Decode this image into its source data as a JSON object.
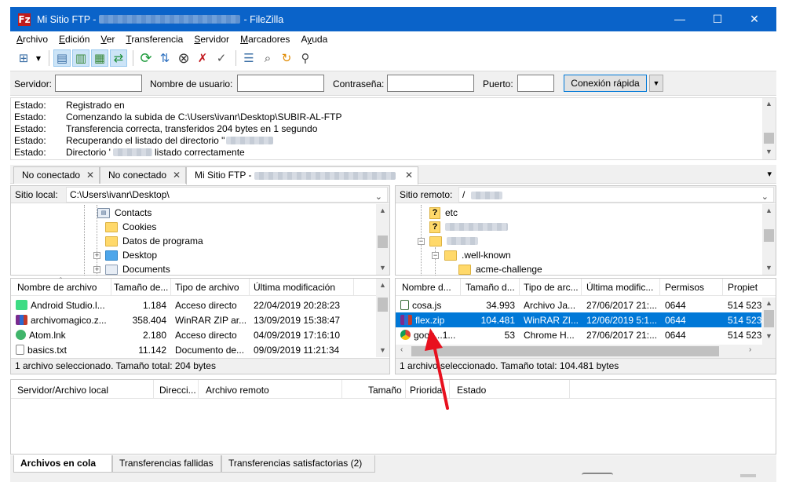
{
  "window": {
    "app_icon": "Fz",
    "title_prefix": "Mi Sitio FTP - ",
    "title_suffix": " - FileZilla",
    "minimize": "—",
    "maximize": "☐",
    "close": "✕"
  },
  "menu": [
    "Archivo",
    "Edición",
    "Ver",
    "Transferencia",
    "Servidor",
    "Marcadores",
    "Ayuda"
  ],
  "menu_mnemonics": [
    "A",
    "E",
    "V",
    "T",
    "S",
    "M",
    "y"
  ],
  "toolbar_icons": [
    "site-manager-icon",
    "dropdown-arrow-icon",
    "toggle-log-icon",
    "toggle-local-tree-icon",
    "toggle-remote-tree-icon",
    "toggle-queue-icon",
    "refresh-icon",
    "process-queue-icon",
    "cancel-icon",
    "disconnect-icon",
    "reconnect-icon",
    "directory-listing-filters-icon",
    "toggle-filename-filters-icon",
    "sync-browsing-icon",
    "search-icon"
  ],
  "quickconnect": {
    "server_label": "Servidor:",
    "user_label": "Nombre de usuario:",
    "password_label": "Contraseña:",
    "port_label": "Puerto:",
    "server_value": "",
    "user_value": "",
    "password_value": "",
    "port_value": "",
    "connect_button": "Conexión rápida",
    "dropdown": "▼"
  },
  "log": [
    {
      "key": "Estado:",
      "msg": "Registrado en"
    },
    {
      "key": "Estado:",
      "msg": "Comenzando la subida de C:\\Users\\ivanr\\Desktop\\SUBIR-AL-FTP"
    },
    {
      "key": "Estado:",
      "msg": "Transferencia correcta, transferidos 204 bytes en 1 segundo"
    },
    {
      "key": "Estado:",
      "msg": "Recuperando el listado del directorio \""
    },
    {
      "key": "Estado:",
      "msg": "Directorio '",
      "msg_after": " listado correctamente"
    }
  ],
  "tabs": [
    {
      "label": "No conectado",
      "close": "✕"
    },
    {
      "label": "No conectado",
      "close": "✕"
    },
    {
      "label": "Mi Sitio FTP - ",
      "close": "✕"
    }
  ],
  "tabs_menu": "▾",
  "local": {
    "site_label": "Sitio local:",
    "path": "C:\\Users\\ivanr\\Desktop\\",
    "tree": [
      {
        "label": "Contacts",
        "icon": "contacts-folder-icon"
      },
      {
        "label": "Cookies",
        "icon": "folder-icon"
      },
      {
        "label": "Datos de programa",
        "icon": "folder-icon"
      },
      {
        "label": "Desktop",
        "icon": "desktop-folder-icon"
      },
      {
        "label": "Documents",
        "icon": "documents-folder-icon"
      }
    ],
    "columns": [
      "Nombre de archivo",
      "Tamaño de...",
      "Tipo de archivo",
      "Última modificación"
    ],
    "files": [
      {
        "name": "Android Studio.l...",
        "size": "1.184",
        "type": "Acceso directo",
        "modified": "22/04/2019 20:28:23",
        "icon": "android-studio-icon"
      },
      {
        "name": "archivomagico.z...",
        "size": "358.404",
        "type": "WinRAR ZIP ar...",
        "modified": "13/09/2019 15:38:47",
        "icon": "winrar-icon"
      },
      {
        "name": "Atom.lnk",
        "size": "2.180",
        "type": "Acceso directo",
        "modified": "04/09/2019 17:16:10",
        "icon": "atom-icon"
      },
      {
        "name": "basics.txt",
        "size": "11.142",
        "type": "Documento de...",
        "modified": "09/09/2019 11:21:34",
        "icon": "text-file-icon"
      }
    ],
    "status": "1 archivo seleccionado. Tamaño total: 204 bytes"
  },
  "remote": {
    "site_label": "Sitio remoto:",
    "path": "/",
    "tree": [
      {
        "label": "etc",
        "icon": "unknown-folder-icon"
      },
      {
        "label": "",
        "icon": "unknown-folder-icon"
      },
      {
        "label": "",
        "icon": "folder-icon"
      },
      {
        "label": ".well-known",
        "icon": "folder-icon"
      },
      {
        "label": "acme-challenge",
        "icon": "folder-icon"
      }
    ],
    "columns": [
      "Nombre d...",
      "Tamaño d...",
      "Tipo de arc...",
      "Última modific...",
      "Permisos",
      "Propiet"
    ],
    "files": [
      {
        "name": "cosa.js",
        "size": "34.993",
        "type": "Archivo Ja...",
        "modified": "27/06/2017 21:...",
        "perms": "0644",
        "owner": "514 523",
        "icon": "js-file-icon",
        "selected": false
      },
      {
        "name": "flex.zip",
        "size": "104.481",
        "type": "WinRAR ZI...",
        "modified": "12/06/2019 5:1...",
        "perms": "0644",
        "owner": "514 523",
        "icon": "winrar-icon",
        "selected": true
      },
      {
        "name": "goog...1...",
        "size": "53",
        "type": "Chrome H...",
        "modified": "27/06/2017 21:...",
        "perms": "0644",
        "owner": "514 523",
        "icon": "chrome-icon",
        "selected": false
      }
    ],
    "status": "1 archivo seleccionado. Tamaño total: 104.481 bytes"
  },
  "queue": {
    "columns": [
      "Servidor/Archivo local",
      "Direcci...",
      "Archivo remoto",
      "Tamaño",
      "Priorida",
      "Estado"
    ],
    "tabs": [
      "Archivos en cola",
      "Transferencias fallidas",
      "Transferencias satisfactorias (2)"
    ]
  },
  "colors": {
    "titlebar": "#0a63c9",
    "selection": "#0078d7",
    "annotation_arrow": "#e8101e"
  }
}
